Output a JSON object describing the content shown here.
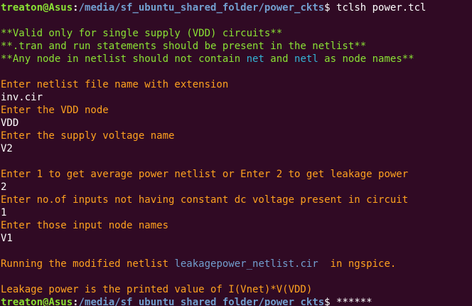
{
  "prompt": {
    "user_host": "treaton@Asus",
    "colon": ":",
    "path": "/media/sf_ubuntu_shared_folder/power_ckts",
    "symbol": "$ ",
    "command": "tclsh power.tcl"
  },
  "notes": {
    "line1": "**Valid only for single supply (VDD) circuits**",
    "line2": "**.tran and run statements should be present in the netlist**",
    "line3_a": "**Any node in netlist should not contain ",
    "line3_net": "net",
    "line3_and": " and ",
    "line3_netl": "netl",
    "line3_b": " as node names**"
  },
  "session": {
    "q1": "Enter netlist file name with extension",
    "a1": "inv.cir",
    "q2": "Enter the VDD node",
    "a2": "VDD",
    "q3": "Enter the supply voltage name",
    "a3": "V2",
    "q4": "Enter 1 to get average power netlist or Enter 2 to get leakage power",
    "a4": "2",
    "q5": "Enter no.of inputs not having constant dc voltage present in circuit",
    "a5": "1",
    "q6": "Enter those input node names",
    "a6": "V1",
    "run_a": "Running the modified netlist ",
    "run_file": "leakagepower_netlist.cir",
    "run_b": "  in ngspice.",
    "result": "Leakage power is the printed value of I(Vnet)*V(VDD)"
  },
  "prompt2": {
    "user_host": "treaton@Asus",
    "colon": ":",
    "path": "/media/sf_ubuntu_shared_folder/power_ckts",
    "symbol": "$ ",
    "typed": "******"
  },
  "colors": {
    "background": "#300a24",
    "prompt_user": "#8ae234",
    "prompt_path": "#729fcf",
    "notes": "#8ae234",
    "questions": "#ffa21f",
    "answers": "#ffffff",
    "file_link": "#729fcf",
    "highlight": "#34b4d6"
  }
}
